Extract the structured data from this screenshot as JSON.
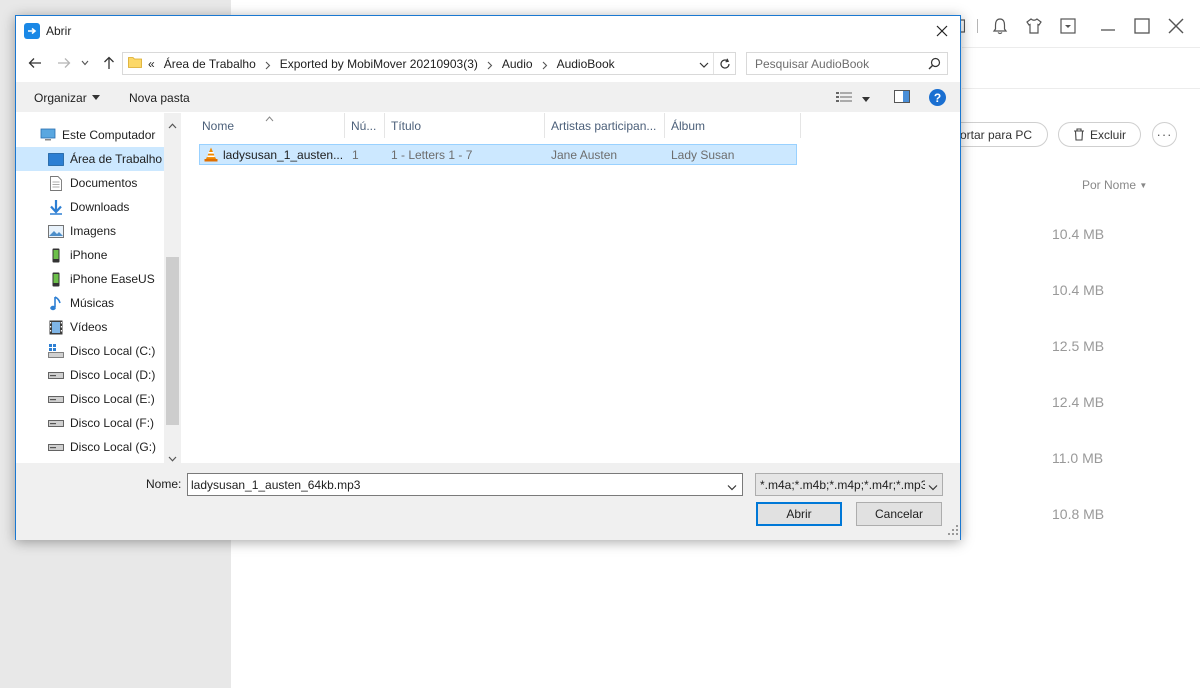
{
  "background_app": {
    "buttons": {
      "export_label": "ortar para PC",
      "delete_label": "Excluir",
      "more_label": "···"
    },
    "sort_label": "Por Nome",
    "sizes": [
      "10.4 MB",
      "10.4 MB",
      "12.5 MB",
      "12.4 MB",
      "11.0 MB",
      "10.8 MB"
    ]
  },
  "dialog": {
    "title": "Abrir",
    "breadcrumb": {
      "overflow": "«",
      "parts": [
        "Área de Trabalho",
        "Exported by MobiMover 20210903(3)",
        "Audio",
        "AudioBook"
      ]
    },
    "search": {
      "placeholder": "Pesquisar AudioBook"
    },
    "toolbar": {
      "organize": "Organizar",
      "new_folder": "Nova pasta"
    },
    "nav": {
      "items": [
        {
          "label": "Este Computador",
          "icon": "computer-icon"
        },
        {
          "label": "Área de Trabalho",
          "icon": "desktop-icon",
          "selected": true
        },
        {
          "label": "Documentos",
          "icon": "documents-icon"
        },
        {
          "label": "Downloads",
          "icon": "downloads-icon"
        },
        {
          "label": "Imagens",
          "icon": "pictures-icon"
        },
        {
          "label": "iPhone",
          "icon": "phone-icon"
        },
        {
          "label": "iPhone EaseUS",
          "icon": "phone-icon"
        },
        {
          "label": "Músicas",
          "icon": "music-icon"
        },
        {
          "label": "Vídeos",
          "icon": "videos-icon"
        },
        {
          "label": "Disco Local (C:)",
          "icon": "system-drive-icon"
        },
        {
          "label": "Disco Local (D:)",
          "icon": "drive-icon"
        },
        {
          "label": "Disco Local (E:)",
          "icon": "drive-icon"
        },
        {
          "label": "Disco Local (F:)",
          "icon": "drive-icon"
        },
        {
          "label": "Disco Local (G:)",
          "icon": "drive-icon"
        }
      ]
    },
    "columns": [
      "Nome",
      "Nú...",
      "Título",
      "Artistas participan...",
      "Álbum"
    ],
    "files": [
      {
        "name": "ladysusan_1_austen...",
        "number": "1",
        "title": "1 - Letters 1 - 7",
        "artists": "Jane Austen",
        "album": "Lady Susan",
        "icon": "vlc-icon",
        "selected": true
      }
    ],
    "filename_label": "Nome:",
    "filename_value": "ladysusan_1_austen_64kb.mp3",
    "filter_value": "*.m4a;*.m4b;*.m4p;*.m4r;*.mp3",
    "open_button": "Abrir",
    "cancel_button": "Cancelar"
  },
  "colors": {
    "accent": "#0078d7",
    "selection": "#cce8ff",
    "selection_border": "#99d1ff",
    "help": "#1a6fd1"
  }
}
